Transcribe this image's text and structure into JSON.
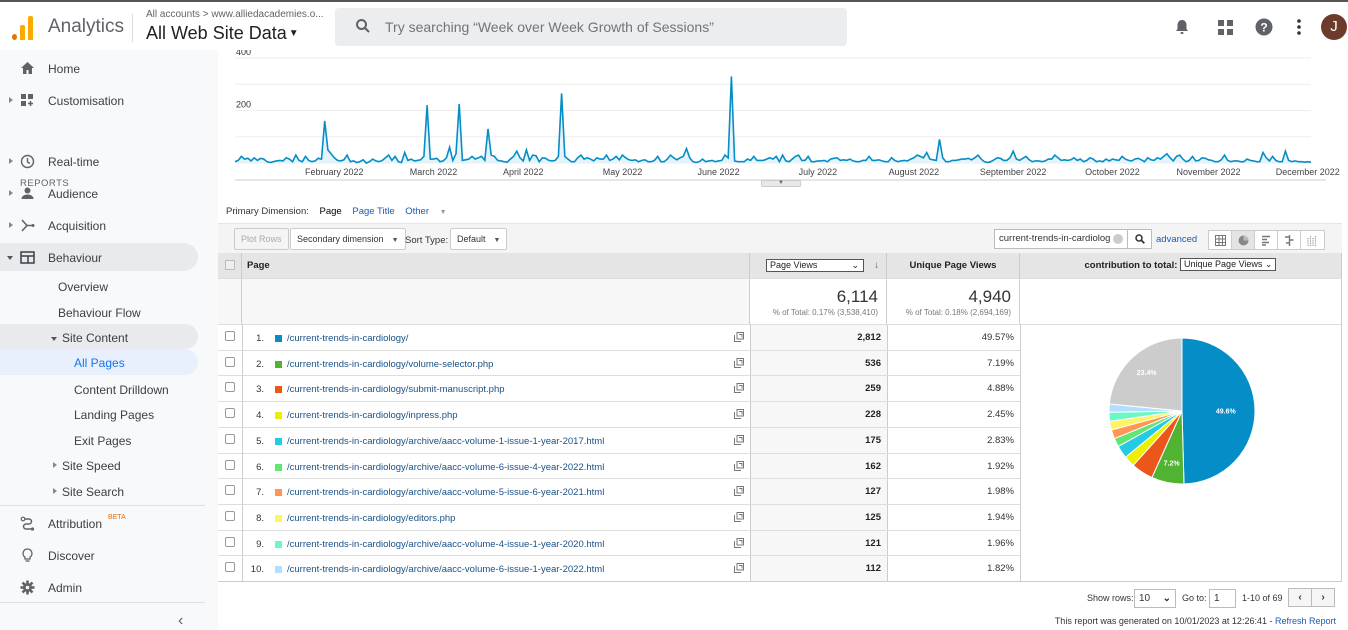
{
  "topbar": {
    "app_name": "Analytics",
    "breadcrumb": "All accounts > www.alliedacademies.o...",
    "view_name": "All Web Site Data",
    "search_placeholder": "Try searching “Week over Week Growth of Sessions”",
    "avatar_letter": "J",
    "icons": [
      "notifications-bell-icon",
      "apps-grid-icon",
      "help-icon",
      "more-vert-icon"
    ]
  },
  "sidebar": {
    "reports_header": "REPORTS",
    "items": [
      {
        "label": "Home",
        "icon": "home-icon"
      },
      {
        "label": "Customisation",
        "icon": "dashboard-plus-icon"
      },
      {
        "label": "Real-time",
        "icon": "clock-icon"
      },
      {
        "label": "Audience",
        "icon": "person-icon"
      },
      {
        "label": "Acquisition",
        "icon": "acquisition-icon"
      },
      {
        "label": "Behaviour",
        "icon": "behaviour-icon"
      },
      {
        "label": "Overview"
      },
      {
        "label": "Behaviour Flow"
      },
      {
        "label": "Site Content"
      },
      {
        "label": "All Pages"
      },
      {
        "label": "Content Drilldown"
      },
      {
        "label": "Landing Pages"
      },
      {
        "label": "Exit Pages"
      },
      {
        "label": "Site Speed"
      },
      {
        "label": "Site Search"
      },
      {
        "label": "Attribution",
        "badge": "BETA",
        "icon": "attribution-icon"
      },
      {
        "label": "Discover",
        "icon": "lightbulb-icon"
      },
      {
        "label": "Admin",
        "icon": "gear-icon"
      }
    ]
  },
  "chart_data": {
    "type": "area",
    "title": "",
    "xlabel": "",
    "ylabel": "Page Views",
    "ylim": [
      0,
      400
    ],
    "yticks": [
      200,
      400
    ],
    "x_tick_labels": [
      "February 2022",
      "March 2022",
      "April 2022",
      "May 2022",
      "June 2022",
      "July 2022",
      "August 2022",
      "September 2022",
      "October 2022",
      "November 2022",
      "December 2022"
    ],
    "color": "#058dc7",
    "series": [
      {
        "name": "Page Views",
        "values": [
          5,
          10,
          25,
          15,
          18,
          8,
          20,
          10,
          18,
          15,
          5,
          2,
          5,
          8,
          10,
          8,
          20,
          15,
          5,
          30,
          10,
          5,
          25,
          10,
          5,
          8,
          18,
          15,
          160,
          50,
          35,
          20,
          10,
          8,
          12,
          30,
          5,
          8,
          2,
          5,
          12,
          0,
          5,
          15,
          8,
          5,
          10,
          20,
          30,
          10,
          25,
          5,
          2,
          40,
          10,
          15,
          8,
          10,
          12,
          25,
          220,
          15,
          15,
          18,
          5,
          8,
          20,
          60,
          10,
          35,
          225,
          10,
          12,
          15,
          25,
          15,
          20,
          25,
          10,
          130,
          30,
          25,
          10,
          8,
          5,
          3,
          15,
          25,
          45,
          20,
          8,
          50,
          10,
          30,
          28,
          5,
          20,
          18,
          10,
          8,
          10,
          25,
          265,
          25,
          15,
          5,
          5,
          20,
          30,
          15,
          20,
          15,
          8,
          20,
          15,
          15,
          30,
          10,
          15,
          25,
          12,
          30,
          20,
          12,
          10,
          12,
          5,
          10,
          12,
          5,
          5,
          10,
          25,
          5,
          5,
          15,
          30,
          20,
          12,
          20,
          25,
          55,
          20,
          5,
          2,
          5,
          15,
          5,
          8,
          10,
          5,
          8,
          10,
          30,
          20,
          330,
          8,
          5,
          5,
          5,
          15,
          10,
          25,
          10,
          10,
          10,
          15,
          20,
          15,
          25,
          5,
          30,
          8,
          5,
          15,
          25,
          30,
          10,
          10,
          25,
          5,
          5,
          8,
          8,
          10,
          5,
          15,
          18,
          20,
          10,
          12,
          10,
          15,
          8,
          5,
          5,
          10,
          10,
          25,
          10,
          10,
          12,
          8,
          5,
          5,
          20,
          10,
          5,
          8,
          10,
          8,
          15,
          20,
          30,
          25,
          20,
          40,
          15,
          12,
          10,
          90,
          20,
          5,
          5,
          10,
          10,
          12,
          15,
          15,
          18,
          12,
          20,
          30,
          15,
          5,
          2,
          5,
          12,
          20,
          18,
          10,
          10,
          20,
          45,
          15,
          10,
          18,
          25,
          12,
          5,
          8,
          8,
          5,
          8,
          15,
          15,
          30,
          20,
          10,
          12,
          10,
          12,
          20,
          10,
          15,
          5,
          10,
          20,
          15,
          5,
          8,
          5,
          15,
          8,
          15,
          12,
          10,
          25,
          15,
          10,
          8,
          15,
          18,
          12,
          5,
          20,
          12,
          10,
          20,
          15,
          25,
          35,
          20,
          8,
          25,
          30,
          15,
          5,
          10,
          25,
          8,
          10,
          20,
          18,
          12,
          10,
          5,
          5,
          12,
          30,
          10,
          5,
          8,
          8,
          5,
          5,
          15,
          10,
          8,
          5,
          5,
          40,
          20,
          8,
          25,
          10,
          5,
          5,
          45,
          10,
          5,
          8,
          5,
          5,
          3,
          5,
          3
        ]
      }
    ]
  },
  "controls": {
    "primary_dimension_label": "Primary Dimension:",
    "primary_dimension_selected": "Page",
    "primary_dimension_options": [
      "Page Title",
      "Other"
    ],
    "plot_rows": "Plot Rows",
    "secondary_dimension": "Secondary dimension",
    "sort_type_label": "Sort Type:",
    "sort_type_value": "Default",
    "filter_value": "current-trends-in-cardiolog",
    "advanced": "advanced",
    "view_modes": [
      "table-view-icon",
      "pie-view-icon",
      "performance-view-icon",
      "comparison-view-icon",
      "pivot-view-icon"
    ]
  },
  "table": {
    "headers": {
      "page": "Page",
      "metric1": "Page Views",
      "metric2": "Unique Page Views",
      "contribution_label": "contribution to total:",
      "contribution_metric": "Unique Page Views"
    },
    "totals": {
      "metric1": "6,114",
      "metric1_sub": "% of Total: 0.17% (3,538,410)",
      "metric2": "4,940",
      "metric2_sub": "% of Total: 0.18% (2,694,169)"
    },
    "rows": [
      {
        "rank": "1.",
        "page": "/current-trends-in-cardiology/",
        "pv": "2,812",
        "upv": "49.57%",
        "color": "#058dc7"
      },
      {
        "rank": "2.",
        "page": "/current-trends-in-cardiology/volume-selector.php",
        "pv": "536",
        "upv": "7.19%",
        "color": "#50b432"
      },
      {
        "rank": "3.",
        "page": "/current-trends-in-cardiology/submit-manuscript.php",
        "pv": "259",
        "upv": "4.88%",
        "color": "#ed561b"
      },
      {
        "rank": "4.",
        "page": "/current-trends-in-cardiology/inpress.php",
        "pv": "228",
        "upv": "2.45%",
        "color": "#edef00"
      },
      {
        "rank": "5.",
        "page": "/current-trends-in-cardiology/archive/aacc-volume-1-issue-1-year-2017.html",
        "pv": "175",
        "upv": "2.83%",
        "color": "#24cbe5"
      },
      {
        "rank": "6.",
        "page": "/current-trends-in-cardiology/archive/aacc-volume-6-issue-4-year-2022.html",
        "pv": "162",
        "upv": "1.92%",
        "color": "#64e572"
      },
      {
        "rank": "7.",
        "page": "/current-trends-in-cardiology/archive/aacc-volume-5-issue-6-year-2021.html",
        "pv": "127",
        "upv": "1.98%",
        "color": "#ff9655"
      },
      {
        "rank": "8.",
        "page": "/current-trends-in-cardiology/editors.php",
        "pv": "125",
        "upv": "1.94%",
        "color": "#fff263"
      },
      {
        "rank": "9.",
        "page": "/current-trends-in-cardiology/archive/aacc-volume-4-issue-1-year-2020.html",
        "pv": "121",
        "upv": "1.96%",
        "color": "#6af9c4"
      },
      {
        "rank": "10.",
        "page": "/current-trends-in-cardiology/archive/aacc-volume-6-issue-1-year-2022.html",
        "pv": "112",
        "upv": "1.82%",
        "color": "#b2deff"
      }
    ],
    "pie": {
      "values": [
        49.57,
        7.19,
        4.88,
        2.45,
        2.83,
        1.92,
        1.98,
        1.94,
        1.96,
        1.82,
        23.46
      ],
      "colors": [
        "#058dc7",
        "#50b432",
        "#ed561b",
        "#edef00",
        "#24cbe5",
        "#64e572",
        "#ff9655",
        "#fff263",
        "#6af9c4",
        "#b2deff",
        "#cccccc"
      ],
      "labels": [
        "49.6%",
        "7.2%",
        "",
        "",
        "",
        "",
        "",
        "",
        "",
        "",
        "23.4%"
      ]
    }
  },
  "pager": {
    "show_rows_label": "Show rows:",
    "show_rows_value": "10",
    "goto_label": "Go to:",
    "goto_value": "1",
    "range": "1-10 of 69",
    "prev": "‹",
    "next": "›"
  },
  "footer": {
    "generated": "This report was generated on 10/01/2023 at 12:26:41 - ",
    "refresh": "Refresh Report"
  }
}
